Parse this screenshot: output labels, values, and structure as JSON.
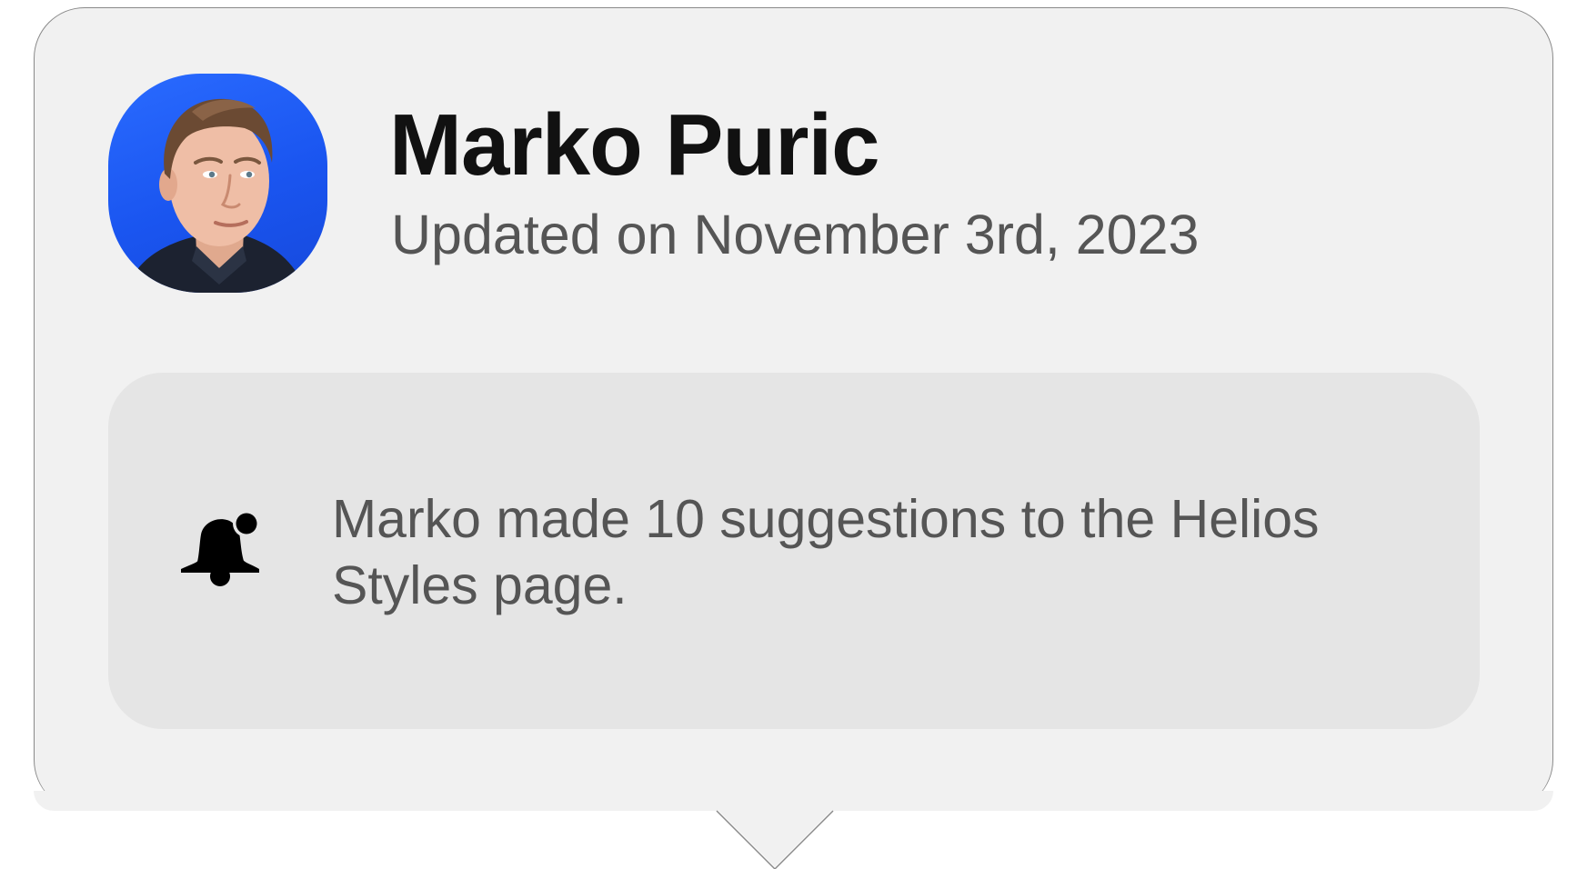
{
  "card": {
    "author_name": "Marko Puric",
    "updated_text": "Updated on November 3rd, 2023"
  },
  "notification": {
    "icon": "bell-notification-icon",
    "message": "Marko made 10 suggestions to the Helios Styles page."
  },
  "colors": {
    "card_background": "#f1f1f1",
    "notice_background": "#e5e5e5",
    "avatar_background": "#1a55f0",
    "name_text": "#111111",
    "secondary_text": "#555555"
  }
}
